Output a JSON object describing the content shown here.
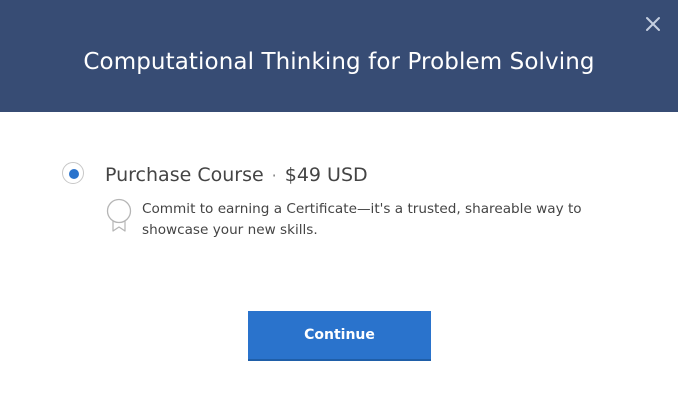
{
  "dialog": {
    "title": "Computational Thinking for Problem Solving",
    "close_icon": "close-icon"
  },
  "option": {
    "selected": true,
    "label": "Purchase Course",
    "separator": "·",
    "price": "$49 USD",
    "icon": "certificate-ribbon-icon",
    "description": "Commit to earning a Certificate—it's a trusted, shareable way to showcase your new skills."
  },
  "actions": {
    "continue_label": "Continue"
  },
  "colors": {
    "header_bg": "#374c74",
    "accent": "#2a73cc"
  }
}
